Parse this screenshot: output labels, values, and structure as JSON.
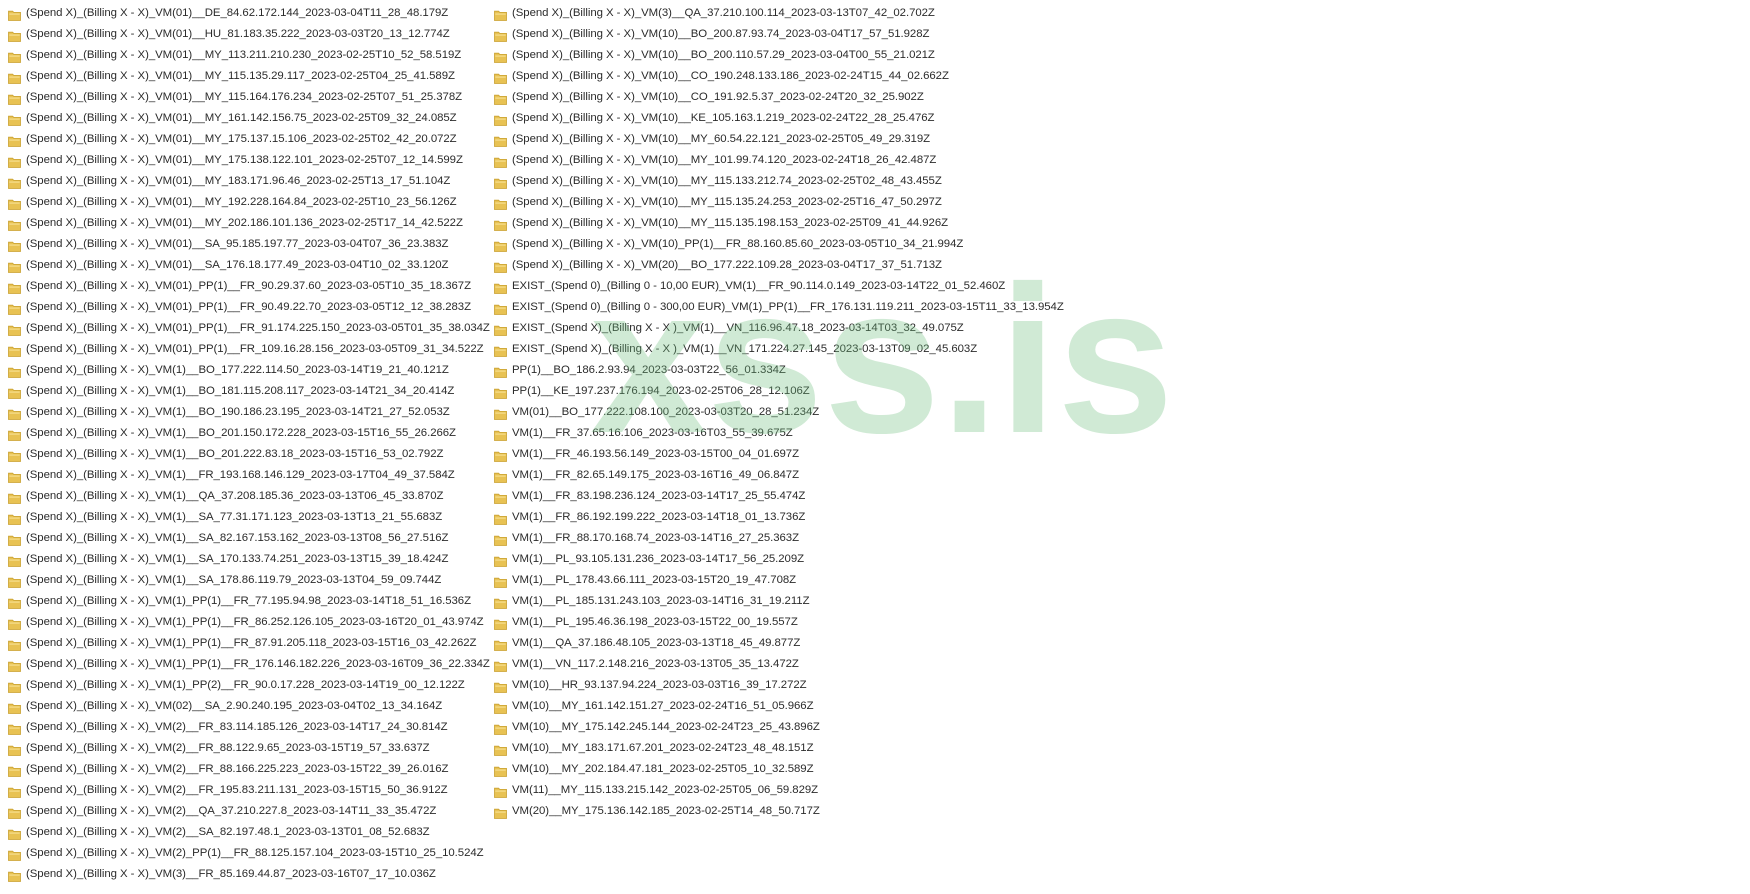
{
  "colors": {
    "folder_body": "#e8c253",
    "folder_edge": "#c9a131",
    "folder_tab": "#f4db86",
    "text": "#2b2b2b",
    "watermark": "#9fd3a8"
  },
  "icon": "folder-icon",
  "watermark": {
    "text": "xss.is"
  },
  "columns": [
    {
      "items": [
        "(Spend X)_(Billing X - X)_VM(01)__DE_84.62.172.144_2023-03-04T11_28_48.179Z",
        "(Spend X)_(Billing X - X)_VM(01)__HU_81.183.35.222_2023-03-03T20_13_12.774Z",
        "(Spend X)_(Billing X - X)_VM(01)__MY_113.211.210.230_2023-02-25T10_52_58.519Z",
        "(Spend X)_(Billing X - X)_VM(01)__MY_115.135.29.117_2023-02-25T04_25_41.589Z",
        "(Spend X)_(Billing X - X)_VM(01)__MY_115.164.176.234_2023-02-25T07_51_25.378Z",
        "(Spend X)_(Billing X - X)_VM(01)__MY_161.142.156.75_2023-02-25T09_32_24.085Z",
        "(Spend X)_(Billing X - X)_VM(01)__MY_175.137.15.106_2023-02-25T02_42_20.072Z",
        "(Spend X)_(Billing X - X)_VM(01)__MY_175.138.122.101_2023-02-25T07_12_14.599Z",
        "(Spend X)_(Billing X - X)_VM(01)__MY_183.171.96.46_2023-02-25T13_17_51.104Z",
        "(Spend X)_(Billing X - X)_VM(01)__MY_192.228.164.84_2023-02-25T10_23_56.126Z",
        "(Spend X)_(Billing X - X)_VM(01)__MY_202.186.101.136_2023-02-25T17_14_42.522Z",
        "(Spend X)_(Billing X - X)_VM(01)__SA_95.185.197.77_2023-03-04T07_36_23.383Z",
        "(Spend X)_(Billing X - X)_VM(01)__SA_176.18.177.49_2023-03-04T10_02_33.120Z",
        "(Spend X)_(Billing X - X)_VM(01)_PP(1)__FR_90.29.37.60_2023-03-05T10_35_18.367Z",
        "(Spend X)_(Billing X - X)_VM(01)_PP(1)__FR_90.49.22.70_2023-03-05T12_12_38.283Z",
        "(Spend X)_(Billing X - X)_VM(01)_PP(1)__FR_91.174.225.150_2023-03-05T01_35_38.034Z",
        "(Spend X)_(Billing X - X)_VM(01)_PP(1)__FR_109.16.28.156_2023-03-05T09_31_34.522Z",
        "(Spend X)_(Billing X - X)_VM(1)__BO_177.222.114.50_2023-03-14T19_21_40.121Z",
        "(Spend X)_(Billing X - X)_VM(1)__BO_181.115.208.117_2023-03-14T21_34_20.414Z",
        "(Spend X)_(Billing X - X)_VM(1)__BO_190.186.23.195_2023-03-14T21_27_52.053Z",
        "(Spend X)_(Billing X - X)_VM(1)__BO_201.150.172.228_2023-03-15T16_55_26.266Z",
        "(Spend X)_(Billing X - X)_VM(1)__BO_201.222.83.18_2023-03-15T16_53_02.792Z",
        "(Spend X)_(Billing X - X)_VM(1)__FR_193.168.146.129_2023-03-17T04_49_37.584Z",
        "(Spend X)_(Billing X - X)_VM(1)__QA_37.208.185.36_2023-03-13T06_45_33.870Z",
        "(Spend X)_(Billing X - X)_VM(1)__SA_77.31.171.123_2023-03-13T13_21_55.683Z",
        "(Spend X)_(Billing X - X)_VM(1)__SA_82.167.153.162_2023-03-13T08_56_27.516Z",
        "(Spend X)_(Billing X - X)_VM(1)__SA_170.133.74.251_2023-03-13T15_39_18.424Z",
        "(Spend X)_(Billing X - X)_VM(1)__SA_178.86.119.79_2023-03-13T04_59_09.744Z",
        "(Spend X)_(Billing X - X)_VM(1)_PP(1)__FR_77.195.94.98_2023-03-14T18_51_16.536Z",
        "(Spend X)_(Billing X - X)_VM(1)_PP(1)__FR_86.252.126.105_2023-03-16T20_01_43.974Z",
        "(Spend X)_(Billing X - X)_VM(1)_PP(1)__FR_87.91.205.118_2023-03-15T16_03_42.262Z",
        "(Spend X)_(Billing X - X)_VM(1)_PP(1)__FR_176.146.182.226_2023-03-16T09_36_22.334Z",
        "(Spend X)_(Billing X - X)_VM(1)_PP(2)__FR_90.0.17.228_2023-03-14T19_00_12.122Z",
        "(Spend X)_(Billing X - X)_VM(02)__SA_2.90.240.195_2023-03-04T02_13_34.164Z",
        "(Spend X)_(Billing X - X)_VM(2)__FR_83.114.185.126_2023-03-14T17_24_30.814Z",
        "(Spend X)_(Billing X - X)_VM(2)__FR_88.122.9.65_2023-03-15T19_57_33.637Z",
        "(Spend X)_(Billing X - X)_VM(2)__FR_88.166.225.223_2023-03-15T22_39_26.016Z",
        "(Spend X)_(Billing X - X)_VM(2)__FR_195.83.211.131_2023-03-15T15_50_36.912Z",
        "(Spend X)_(Billing X - X)_VM(2)__QA_37.210.227.8_2023-03-14T11_33_35.472Z",
        "(Spend X)_(Billing X - X)_VM(2)__SA_82.197.48.1_2023-03-13T01_08_52.683Z",
        "(Spend X)_(Billing X - X)_VM(2)_PP(1)__FR_88.125.157.104_2023-03-15T10_25_10.524Z",
        "(Spend X)_(Billing X - X)_VM(3)__FR_85.169.44.87_2023-03-16T07_17_10.036Z"
      ]
    },
    {
      "items": [
        "(Spend X)_(Billing X - X)_VM(3)__QA_37.210.100.114_2023-03-13T07_42_02.702Z",
        "(Spend X)_(Billing X - X)_VM(10)__BO_200.87.93.74_2023-03-04T17_57_51.928Z",
        "(Spend X)_(Billing X - X)_VM(10)__BO_200.110.57.29_2023-03-04T00_55_21.021Z",
        "(Spend X)_(Billing X - X)_VM(10)__CO_190.248.133.186_2023-02-24T15_44_02.662Z",
        "(Spend X)_(Billing X - X)_VM(10)__CO_191.92.5.37_2023-02-24T20_32_25.902Z",
        "(Spend X)_(Billing X - X)_VM(10)__KE_105.163.1.219_2023-02-24T22_28_25.476Z",
        "(Spend X)_(Billing X - X)_VM(10)__MY_60.54.22.121_2023-02-25T05_49_29.319Z",
        "(Spend X)_(Billing X - X)_VM(10)__MY_101.99.74.120_2023-02-24T18_26_42.487Z",
        "(Spend X)_(Billing X - X)_VM(10)__MY_115.133.212.74_2023-02-25T02_48_43.455Z",
        "(Spend X)_(Billing X - X)_VM(10)__MY_115.135.24.253_2023-02-25T16_47_50.297Z",
        "(Spend X)_(Billing X - X)_VM(10)__MY_115.135.198.153_2023-02-25T09_41_44.926Z",
        "(Spend X)_(Billing X - X)_VM(10)_PP(1)__FR_88.160.85.60_2023-03-05T10_34_21.994Z",
        "(Spend X)_(Billing X - X)_VM(20)__BO_177.222.109.28_2023-03-04T17_37_51.713Z",
        "EXIST_(Spend 0)_(Billing 0 - 10,00 EUR)_VM(1)__FR_90.114.0.149_2023-03-14T22_01_52.460Z",
        "EXIST_(Spend 0)_(Billing 0 - 300,00 EUR)_VM(1)_PP(1)__FR_176.131.119.211_2023-03-15T11_33_13.954Z",
        "EXIST_(Spend X)_(Billing X - X )_VM(1)__VN_116.96.47.18_2023-03-14T03_32_49.075Z",
        "EXIST_(Spend X)_(Billing X - X )_VM(1)__VN_171.224.27.145_2023-03-13T09_02_45.603Z",
        "PP(1)__BO_186.2.93.94_2023-03-03T22_56_01.334Z",
        "PP(1)__KE_197.237.176.194_2023-02-25T06_28_12.106Z",
        "VM(01)__BO_177.222.108.100_2023-03-03T20_28_51.234Z",
        "VM(1)__FR_37.65.16.106_2023-03-16T03_55_39.675Z",
        "VM(1)__FR_46.193.56.149_2023-03-15T00_04_01.697Z",
        "VM(1)__FR_82.65.149.175_2023-03-16T16_49_06.847Z",
        "VM(1)__FR_83.198.236.124_2023-03-14T17_25_55.474Z",
        "VM(1)__FR_86.192.199.222_2023-03-14T18_01_13.736Z",
        "VM(1)__FR_88.170.168.74_2023-03-14T16_27_25.363Z",
        "VM(1)__PL_93.105.131.236_2023-03-14T17_56_25.209Z",
        "VM(1)__PL_178.43.66.111_2023-03-15T20_19_47.708Z",
        "VM(1)__PL_185.131.243.103_2023-03-14T16_31_19.211Z",
        "VM(1)__PL_195.46.36.198_2023-03-15T22_00_19.557Z",
        "VM(1)__QA_37.186.48.105_2023-03-13T18_45_49.877Z",
        "VM(1)__VN_117.2.148.216_2023-03-13T05_35_13.472Z",
        "VM(10)__HR_93.137.94.224_2023-03-03T16_39_17.272Z",
        "VM(10)__MY_161.142.151.27_2023-02-24T16_51_05.966Z",
        "VM(10)__MY_175.142.245.144_2023-02-24T23_25_43.896Z",
        "VM(10)__MY_183.171.67.201_2023-02-24T23_48_48.151Z",
        "VM(10)__MY_202.184.47.181_2023-02-25T05_10_32.589Z",
        "VM(11)__MY_115.133.215.142_2023-02-25T05_06_59.829Z",
        "VM(20)__MY_175.136.142.185_2023-02-25T14_48_50.717Z"
      ]
    }
  ]
}
